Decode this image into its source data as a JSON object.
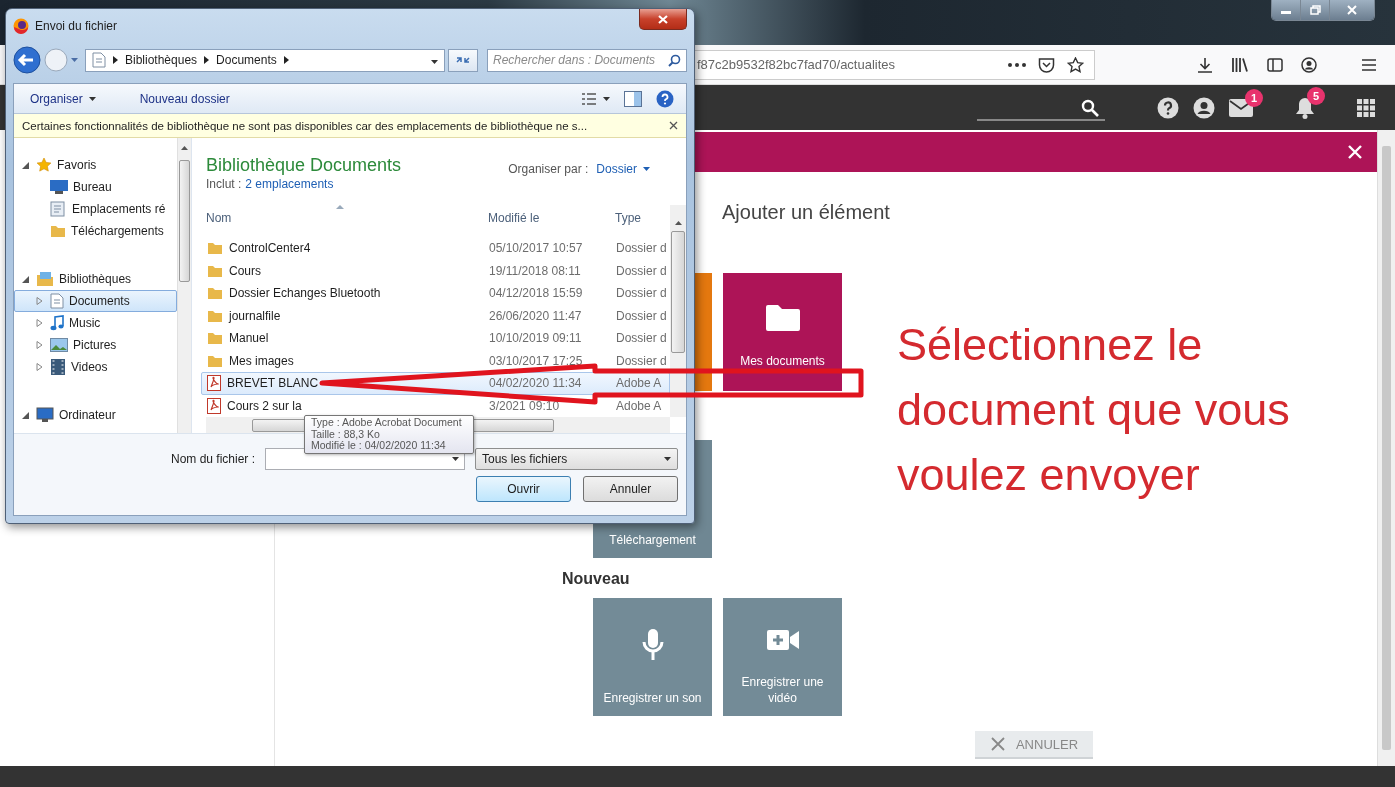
{
  "browser": {
    "url": "f87c2b9532f82bc7fad70/actualites",
    "mail_badge": "1",
    "notification_badge": "5"
  },
  "modal": {
    "heading": "Ajouter un élément",
    "tiles": [
      {
        "kind": "plain",
        "color": "#e4780f"
      },
      {
        "kind": "folder",
        "label": "Mes documents",
        "color": "#ad1457"
      },
      {
        "kind": "plain",
        "label": "Téléchargement",
        "color": "#6f8793"
      }
    ],
    "new_section": "Nouveau",
    "new_tiles": [
      {
        "kind": "microphone",
        "label": "Enregistrer un son"
      },
      {
        "kind": "video",
        "label": "Enregistrer une vidéo"
      }
    ],
    "cancel": "ANNULER"
  },
  "annotation": {
    "text": "Sélectionnez le document que vous voulez envoyer"
  },
  "dialog": {
    "title": "Envoi du fichier",
    "path": [
      "Bibliothèques",
      "Documents"
    ],
    "search_placeholder": "Rechercher dans : Documents",
    "toolbar": [
      "Organiser",
      "Nouveau dossier"
    ],
    "info_bar": "Certaines fonctionnalités de bibliothèque ne sont pas disponibles car des emplacements de bibliothèque ne s...",
    "nav": [
      {
        "kind": "star",
        "label": "Favoris",
        "expanded": true,
        "selected": false,
        "children": [
          {
            "kind": "desktop",
            "label": "Bureau",
            "selected": false
          },
          {
            "kind": "places",
            "label": "Emplacements ré",
            "selected": false
          },
          {
            "kind": "folder",
            "label": "Téléchargements",
            "selected": false
          }
        ]
      },
      {
        "kind": "library",
        "label": "Bibliothèques",
        "expanded": true,
        "selected": false,
        "children": [
          {
            "kind": "document",
            "label": "Documents",
            "expanded": false,
            "selected": true
          },
          {
            "kind": "music",
            "label": "Music",
            "expanded": false,
            "selected": false
          },
          {
            "kind": "picture",
            "label": "Pictures",
            "expanded": false,
            "selected": false
          },
          {
            "kind": "film",
            "label": "Videos",
            "expanded": false,
            "selected": false
          }
        ]
      },
      {
        "kind": "computer",
        "label": "Ordinateur",
        "expanded": true,
        "selected": false
      }
    ],
    "library": {
      "title": "Bibliothèque Documents",
      "includes_label": "Inclut :",
      "includes_link": "2 emplacements",
      "arrange_label": "Organiser par :",
      "arrange_value": "Dossier"
    },
    "columns": [
      "Nom",
      "Modifié le",
      "Type"
    ],
    "files": [
      {
        "kind": "folder",
        "name": "ControlCenter4",
        "modified": "05/10/2017 10:57",
        "type": "Dossier d",
        "selected": false
      },
      {
        "kind": "folder",
        "name": "Cours",
        "modified": "19/11/2018 08:11",
        "type": "Dossier d",
        "selected": false
      },
      {
        "kind": "folder",
        "name": "Dossier Echanges Bluetooth",
        "modified": "04/12/2018 15:59",
        "type": "Dossier d",
        "selected": false
      },
      {
        "kind": "folder",
        "name": "journalfile",
        "modified": "26/06/2020 11:47",
        "type": "Dossier d",
        "selected": false
      },
      {
        "kind": "folder",
        "name": "Manuel",
        "modified": "10/10/2019 09:11",
        "type": "Dossier d",
        "selected": false
      },
      {
        "kind": "folder",
        "name": "Mes images",
        "modified": "03/10/2017 17:25",
        "type": "Dossier d",
        "selected": false
      },
      {
        "kind": "pdf",
        "name": "BREVET BLANC",
        "modified": "04/02/2020 11:34",
        "type": "Adobe A",
        "selected": true
      },
      {
        "kind": "pdf",
        "name": "Cours 2 sur la",
        "modified": "3/2021 09:10",
        "type": "Adobe A",
        "selected": false
      }
    ],
    "tooltip": [
      "Type : Adobe Acrobat Document",
      "Taille : 88,3 Ko",
      "Modifié le : 04/02/2020 11:34"
    ],
    "filename_label": "Nom du fichier :",
    "filter": "Tous les fichiers",
    "buttons": [
      "Ouvrir",
      "Annuler"
    ]
  }
}
